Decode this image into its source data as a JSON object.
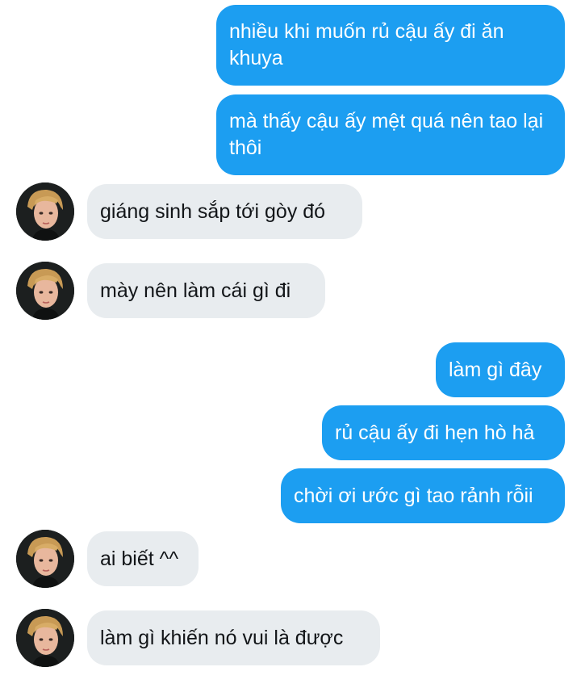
{
  "conversation": {
    "messages": [
      {
        "from": "me",
        "text": "nhiều khi muốn rủ cậu ấy đi ăn khuya"
      },
      {
        "from": "me",
        "text": "mà thấy cậu ấy mệt quá nên tao lại thôi"
      },
      {
        "from": "other",
        "text": "giáng sinh sắp tới gòy đó"
      },
      {
        "from": "other",
        "text": "mày nên làm cái gì đi"
      },
      {
        "from": "me",
        "text": "làm gì đây"
      },
      {
        "from": "me",
        "text": "rủ cậu ấy đi hẹn hò hả"
      },
      {
        "from": "me",
        "text": "chời ơi ước gì tao rảnh rỗii"
      },
      {
        "from": "other",
        "text": "ai biết ^^"
      },
      {
        "from": "other",
        "text": "làm gì khiến nó vui là được"
      }
    ]
  },
  "colors": {
    "outgoing_bubble": "#1c9ef1",
    "incoming_bubble": "#e8ecef",
    "outgoing_text": "#ffffff",
    "incoming_text": "#121518"
  },
  "icons": {
    "avatar": "user-avatar-icon"
  }
}
